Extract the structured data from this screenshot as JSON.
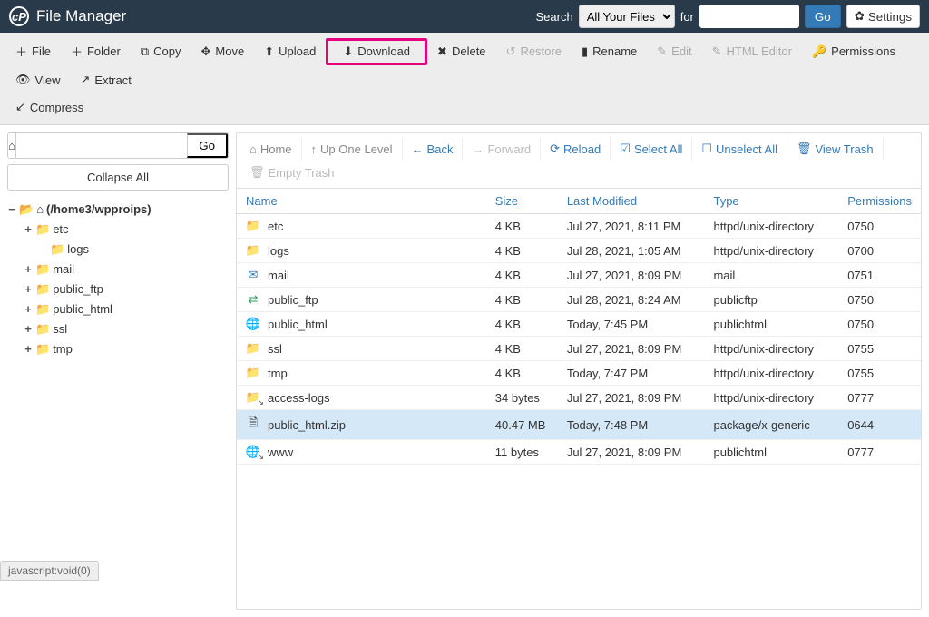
{
  "header": {
    "app_title": "File Manager",
    "search_label": "Search",
    "search_for_label": "for",
    "search_scope": "All Your Files",
    "search_query": "",
    "go_label": "Go",
    "settings_label": "Settings"
  },
  "toolbar": {
    "file": "File",
    "folder": "Folder",
    "copy": "Copy",
    "move": "Move",
    "upload": "Upload",
    "download": "Download",
    "delete": "Delete",
    "restore": "Restore",
    "rename": "Rename",
    "edit": "Edit",
    "html_editor": "HTML Editor",
    "permissions": "Permissions",
    "view": "View",
    "extract": "Extract",
    "compress": "Compress"
  },
  "sidebar": {
    "path_value": "",
    "go_label": "Go",
    "collapse_all": "Collapse All",
    "root_label": "(/home3/wpproips)",
    "items": [
      {
        "label": "etc",
        "expandable": true
      },
      {
        "label": "logs",
        "expandable": false,
        "indent": true
      },
      {
        "label": "mail",
        "expandable": true
      },
      {
        "label": "public_ftp",
        "expandable": true
      },
      {
        "label": "public_html",
        "expandable": true
      },
      {
        "label": "ssl",
        "expandable": true
      },
      {
        "label": "tmp",
        "expandable": true
      }
    ]
  },
  "actionbar": {
    "home": "Home",
    "up_one": "Up One Level",
    "back": "Back",
    "forward": "Forward",
    "reload": "Reload",
    "select_all": "Select All",
    "unselect_all": "Unselect All",
    "view_trash": "View Trash",
    "empty_trash": "Empty Trash"
  },
  "columns": {
    "name": "Name",
    "size": "Size",
    "last_modified": "Last Modified",
    "type": "Type",
    "permissions": "Permissions"
  },
  "rows": [
    {
      "icon": "folder",
      "name": "etc",
      "size": "4 KB",
      "modified": "Jul 27, 2021, 8:11 PM",
      "type": "httpd/unix-directory",
      "perm": "0750"
    },
    {
      "icon": "folder",
      "name": "logs",
      "size": "4 KB",
      "modified": "Jul 28, 2021, 1:05 AM",
      "type": "httpd/unix-directory",
      "perm": "0700"
    },
    {
      "icon": "mail",
      "name": "mail",
      "size": "4 KB",
      "modified": "Jul 27, 2021, 8:09 PM",
      "type": "mail",
      "perm": "0751"
    },
    {
      "icon": "ftp",
      "name": "public_ftp",
      "size": "4 KB",
      "modified": "Jul 28, 2021, 8:24 AM",
      "type": "publicftp",
      "perm": "0750"
    },
    {
      "icon": "globe",
      "name": "public_html",
      "size": "4 KB",
      "modified": "Today, 7:45 PM",
      "type": "publichtml",
      "perm": "0750"
    },
    {
      "icon": "folder",
      "name": "ssl",
      "size": "4 KB",
      "modified": "Jul 27, 2021, 8:09 PM",
      "type": "httpd/unix-directory",
      "perm": "0755"
    },
    {
      "icon": "folder",
      "name": "tmp",
      "size": "4 KB",
      "modified": "Today, 7:47 PM",
      "type": "httpd/unix-directory",
      "perm": "0755"
    },
    {
      "icon": "folder-link",
      "name": "access-logs",
      "size": "34 bytes",
      "modified": "Jul 27, 2021, 8:09 PM",
      "type": "httpd/unix-directory",
      "perm": "0777"
    },
    {
      "icon": "file",
      "name": "public_html.zip",
      "size": "40.47 MB",
      "modified": "Today, 7:48 PM",
      "type": "package/x-generic",
      "perm": "0644",
      "selected": true
    },
    {
      "icon": "globe-link",
      "name": "www",
      "size": "11 bytes",
      "modified": "Jul 27, 2021, 8:09 PM",
      "type": "publichtml",
      "perm": "0777"
    }
  ],
  "status_bar": "javascript:void(0)"
}
